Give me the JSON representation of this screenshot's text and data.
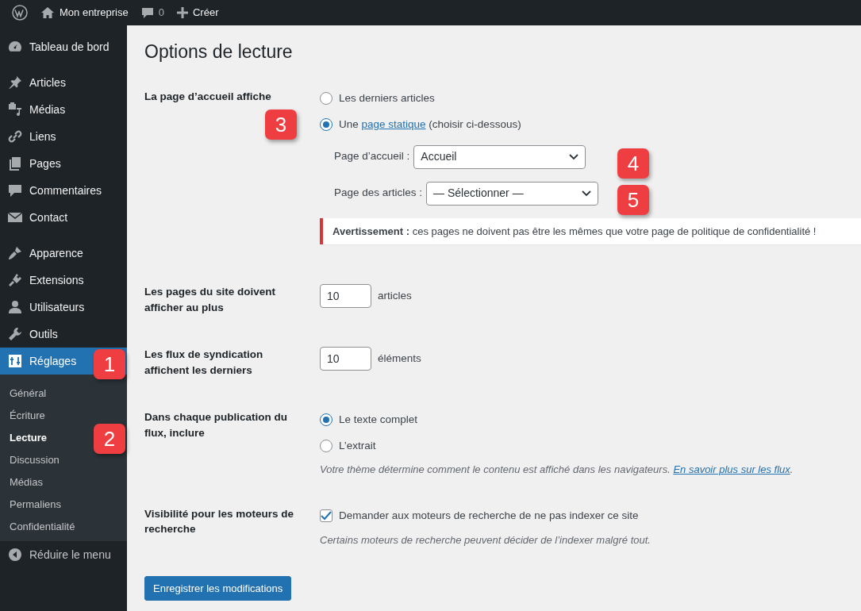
{
  "topbar": {
    "site_name": "Mon entreprise",
    "comments_count": "0",
    "new_label": "Créer"
  },
  "sidebar": {
    "groups": [
      {
        "items": [
          {
            "label": "Tableau de bord",
            "selected": false
          }
        ]
      },
      {
        "items": [
          {
            "label": "Articles",
            "selected": false
          },
          {
            "label": "Médias",
            "selected": false
          },
          {
            "label": "Liens",
            "selected": false
          },
          {
            "label": "Pages",
            "selected": false
          },
          {
            "label": "Commentaires",
            "selected": false
          },
          {
            "label": "Contact",
            "selected": false
          }
        ]
      },
      {
        "items": [
          {
            "label": "Apparence",
            "selected": false
          },
          {
            "label": "Extensions",
            "selected": false
          },
          {
            "label": "Utilisateurs",
            "selected": false
          },
          {
            "label": "Outils",
            "selected": false
          },
          {
            "label": "Réglages",
            "selected": true,
            "children": [
              {
                "label": "Général",
                "selected": false
              },
              {
                "label": "Écriture",
                "selected": false
              },
              {
                "label": "Lecture",
                "selected": true
              },
              {
                "label": "Discussion",
                "selected": false
              },
              {
                "label": "Médias",
                "selected": false
              },
              {
                "label": "Permaliens",
                "selected": false
              },
              {
                "label": "Confidentialité",
                "selected": false
              }
            ]
          }
        ]
      }
    ],
    "collapse_label": "Réduire le menu"
  },
  "page": {
    "title": "Options de lecture",
    "rows": [
      {
        "kind": "radios",
        "label": "La page d’accueil affiche",
        "options": [
          {
            "text": "Les derniers articles",
            "selected": false
          },
          {
            "text": "Une",
            "link": "page statique",
            "text_after": "(choisir ci-dessous)",
            "selected": true
          }
        ],
        "selects": [
          {
            "label": "Page d’accueil :",
            "value": "Accueil"
          },
          {
            "label": "Page des articles :",
            "value": "— Sélectionner —"
          }
        ],
        "warning": "**Avertissement :** ces pages ne doivent pas être les mêmes que votre page de politique de confidentialité !"
      },
      {
        "kind": "number",
        "label": "Les pages du site doivent afficher au plus",
        "value": "10",
        "unit": "articles"
      },
      {
        "kind": "number",
        "label": "Les flux de syndication affichent les derniers",
        "value": "10",
        "unit": "éléments"
      },
      {
        "kind": "radios",
        "label": "Dans chaque publication du flux, inclure",
        "options": [
          {
            "text": "Le texte complet",
            "selected": true
          },
          {
            "text": "L’extrait",
            "selected": false
          }
        ],
        "description": "Votre thème détermine comment le contenu est affiché dans les navigateurs.",
        "description_link": "En savoir plus sur les flux",
        "description_end": "."
      },
      {
        "kind": "checkbox",
        "label": "Visibilité pour les moteurs de recherche",
        "text": "Demander aux moteurs de recherche de ne pas indexer ce site",
        "checked": true,
        "description": "Certains moteurs de recherche peuvent décider de l’indexer malgré tout."
      }
    ],
    "save_button": "Enregistrer les modifications"
  },
  "callouts": [
    {
      "number": "1"
    },
    {
      "number": "2"
    },
    {
      "number": "3"
    },
    {
      "number": "4"
    },
    {
      "number": "5"
    }
  ]
}
